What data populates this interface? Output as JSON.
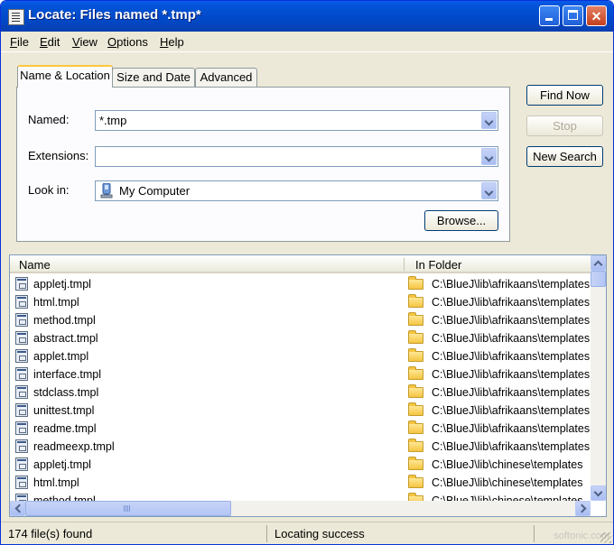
{
  "window": {
    "title": "Locate: Files named *.tmp*"
  },
  "menu": [
    "File",
    "Edit",
    "View",
    "Options",
    "Help"
  ],
  "tabs": [
    {
      "label": "Name & Location",
      "active": true
    },
    {
      "label": "Size and Date",
      "active": false
    },
    {
      "label": "Advanced",
      "active": false
    }
  ],
  "form": {
    "named_label": "Named:",
    "named_value": "*.tmp",
    "extensions_label": "Extensions:",
    "extensions_value": "",
    "lookin_label": "Look in:",
    "lookin_value": "My Computer",
    "browse_label": "Browse..."
  },
  "actions": {
    "find_now": "Find Now",
    "stop": "Stop",
    "new_search": "New Search"
  },
  "results": {
    "columns": [
      "Name",
      "In Folder"
    ],
    "rows": [
      {
        "name": "appletj.tmpl",
        "folder": "C:\\BlueJ\\lib\\afrikaans\\templates"
      },
      {
        "name": "html.tmpl",
        "folder": "C:\\BlueJ\\lib\\afrikaans\\templates"
      },
      {
        "name": "method.tmpl",
        "folder": "C:\\BlueJ\\lib\\afrikaans\\templates"
      },
      {
        "name": "abstract.tmpl",
        "folder": "C:\\BlueJ\\lib\\afrikaans\\templates"
      },
      {
        "name": "applet.tmpl",
        "folder": "C:\\BlueJ\\lib\\afrikaans\\templates"
      },
      {
        "name": "interface.tmpl",
        "folder": "C:\\BlueJ\\lib\\afrikaans\\templates"
      },
      {
        "name": "stdclass.tmpl",
        "folder": "C:\\BlueJ\\lib\\afrikaans\\templates"
      },
      {
        "name": "unittest.tmpl",
        "folder": "C:\\BlueJ\\lib\\afrikaans\\templates"
      },
      {
        "name": "readme.tmpl",
        "folder": "C:\\BlueJ\\lib\\afrikaans\\templates"
      },
      {
        "name": "readmeexp.tmpl",
        "folder": "C:\\BlueJ\\lib\\afrikaans\\templates"
      },
      {
        "name": "appletj.tmpl",
        "folder": "C:\\BlueJ\\lib\\chinese\\templates"
      },
      {
        "name": "html.tmpl",
        "folder": "C:\\BlueJ\\lib\\chinese\\templates"
      },
      {
        "name": "method.tmpl",
        "folder": "C:\\BlueJ\\lib\\chinese\\templates"
      }
    ]
  },
  "status": {
    "count": "174 file(s) found",
    "message": "Locating success",
    "watermark": "softonic.com"
  }
}
